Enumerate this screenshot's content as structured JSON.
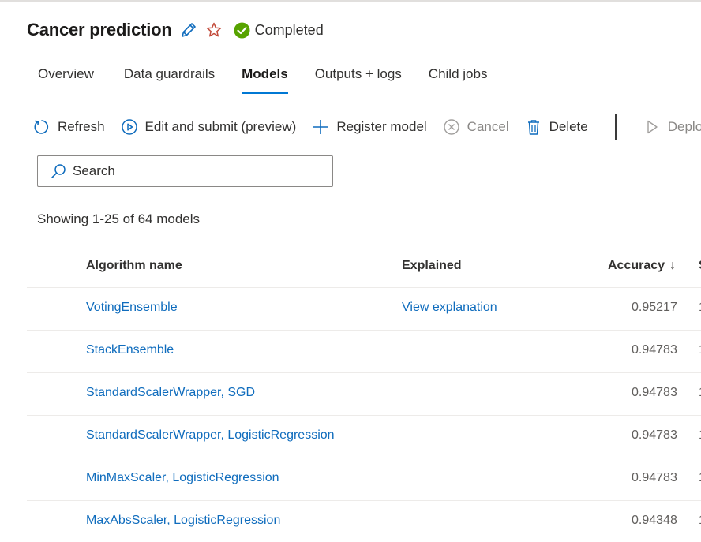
{
  "header": {
    "title": "Cancer prediction",
    "status": "Completed",
    "colors": {
      "status_ok": "#57a300",
      "star": "#c24a3a",
      "edit": "#0f6cbd"
    }
  },
  "tabs": [
    {
      "label": "Overview",
      "active": false
    },
    {
      "label": "Data guardrails",
      "active": false
    },
    {
      "label": "Models",
      "active": true
    },
    {
      "label": "Outputs + logs",
      "active": false
    },
    {
      "label": "Child jobs",
      "active": false
    }
  ],
  "toolbar": {
    "refresh": "Refresh",
    "edit_submit": "Edit and submit (preview)",
    "register": "Register model",
    "cancel": "Cancel",
    "delete": "Delete",
    "deploy": "Deplo"
  },
  "search": {
    "placeholder": "Search"
  },
  "summary": "Showing 1-25 of 64 models",
  "table": {
    "columns": {
      "name": "Algorithm name",
      "explained": "Explained",
      "accuracy": "Accuracy",
      "sort_icon": "↓",
      "next": "S"
    },
    "rows": [
      {
        "name": "VotingEnsemble",
        "explained": "View explanation",
        "accuracy": "0.95217",
        "extra": "1"
      },
      {
        "name": "StackEnsemble",
        "explained": "",
        "accuracy": "0.94783",
        "extra": "1"
      },
      {
        "name": "StandardScalerWrapper, SGD",
        "explained": "",
        "accuracy": "0.94783",
        "extra": "1"
      },
      {
        "name": "StandardScalerWrapper, LogisticRegression",
        "explained": "",
        "accuracy": "0.94783",
        "extra": "1"
      },
      {
        "name": "MinMaxScaler, LogisticRegression",
        "explained": "",
        "accuracy": "0.94783",
        "extra": "1"
      },
      {
        "name": "MaxAbsScaler, LogisticRegression",
        "explained": "",
        "accuracy": "0.94348",
        "extra": "1"
      }
    ]
  }
}
